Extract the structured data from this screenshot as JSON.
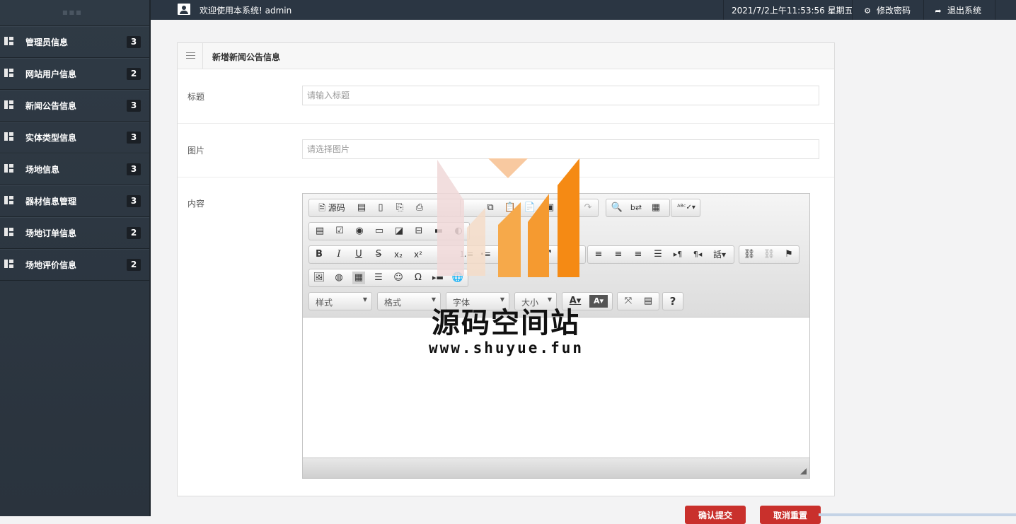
{
  "sidebar": {
    "items": [
      {
        "label": "管理员信息",
        "count": "3"
      },
      {
        "label": "网站用户信息",
        "count": "2"
      },
      {
        "label": "新闻公告信息",
        "count": "3"
      },
      {
        "label": "实体类型信息",
        "count": "3"
      },
      {
        "label": "场地信息",
        "count": "3"
      },
      {
        "label": "器材信息管理",
        "count": "3"
      },
      {
        "label": "场地订单信息",
        "count": "2"
      },
      {
        "label": "场地评价信息",
        "count": "2"
      }
    ]
  },
  "topbar": {
    "welcome": "欢迎使用本系统! admin",
    "datetime": "2021/7/2上午11:53:56 星期五",
    "change_password": "修改密码",
    "logout": "退出系统"
  },
  "panel": {
    "title": "新增新闻公告信息",
    "fields": {
      "title_label": "标题",
      "title_placeholder": "请输入标题",
      "image_label": "图片",
      "image_placeholder": "请选择图片",
      "content_label": "内容"
    }
  },
  "editor": {
    "source_label": "源码",
    "style_select": "样式",
    "format_select": "格式",
    "font_select": "字体",
    "size_select": "大小",
    "help_label": "?"
  },
  "watermark": {
    "text": "源码空间站",
    "url": "www.shuyue.fun"
  },
  "buttons": {
    "submit": "确认提交",
    "reset": "取消重置"
  }
}
